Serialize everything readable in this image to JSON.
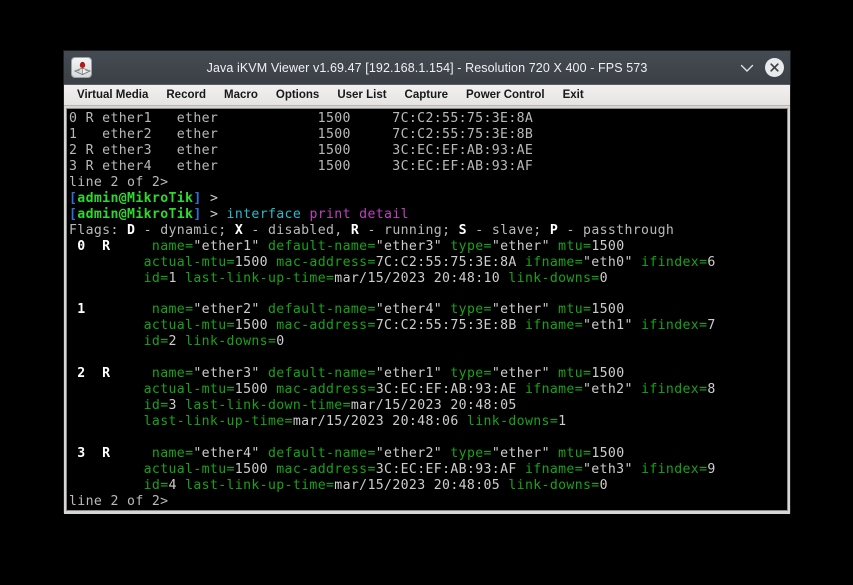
{
  "window": {
    "title": "Java iKVM Viewer v1.69.47 [192.168.1.154] - Resolution 720 X 400 - FPS 573",
    "app_icon": "java-ikvm-icon",
    "minimize_label": "⌄",
    "close_label": "✕"
  },
  "menubar": {
    "items": [
      {
        "label": "Virtual Media"
      },
      {
        "label": "Record"
      },
      {
        "label": "Macro"
      },
      {
        "label": "Options"
      },
      {
        "label": "User List"
      },
      {
        "label": "Capture"
      },
      {
        "label": "Power Control"
      },
      {
        "label": "Exit"
      }
    ]
  },
  "terminal": {
    "interface_table": [
      {
        "index": "0",
        "flags": "R",
        "name": "ether1",
        "type": "ether",
        "mtu": "1500",
        "mac": "7C:C2:55:75:3E:8A"
      },
      {
        "index": "1",
        "flags": "",
        "name": "ether2",
        "type": "ether",
        "mtu": "1500",
        "mac": "7C:C2:55:75:3E:8B"
      },
      {
        "index": "2",
        "flags": "R",
        "name": "ether3",
        "type": "ether",
        "mtu": "1500",
        "mac": "3C:EC:EF:AB:93:AE"
      },
      {
        "index": "3",
        "flags": "R",
        "name": "ether4",
        "type": "ether",
        "mtu": "1500",
        "mac": "3C:EC:EF:AB:93:AF"
      }
    ],
    "pager_top": "line 2 of 2>",
    "pager_bottom": "line 2 of 2>",
    "prompt_user": "admin@MikroTik",
    "prompt_bracket_open": "[",
    "prompt_bracket_close": "]",
    "prompt_arrow": ">",
    "command_part1": "interface",
    "command_part2": "print detail",
    "flags_line": "Flags: D - dynamic; X - disabled, R - running; S - slave; P - passthrough",
    "flags_prefix": "Flags: ",
    "flags_tokens": [
      {
        "flag": "D",
        "desc": " - dynamic; "
      },
      {
        "flag": "X",
        "desc": " - disabled, "
      },
      {
        "flag": "R",
        "desc": " - running; "
      },
      {
        "flag": "S",
        "desc": " - slave; "
      },
      {
        "flag": "P",
        "desc": " - passthrough"
      }
    ],
    "detail_entries": [
      {
        "index": "0",
        "flags": "R",
        "name": "ether1",
        "default_name": "ether3",
        "type": "ether",
        "mtu": "1500",
        "actual_mtu": "1500",
        "mac_address": "7C:C2:55:75:3E:8A",
        "ifname": "eth0",
        "ifindex": "6",
        "id": "1",
        "last_link_down_time": "",
        "last_link_up_time": "mar/15/2023 20:48:10",
        "link_downs": "0"
      },
      {
        "index": "1",
        "flags": "",
        "name": "ether2",
        "default_name": "ether4",
        "type": "ether",
        "mtu": "1500",
        "actual_mtu": "1500",
        "mac_address": "7C:C2:55:75:3E:8B",
        "ifname": "eth1",
        "ifindex": "7",
        "id": "2",
        "last_link_down_time": "",
        "last_link_up_time": "",
        "link_downs": "0"
      },
      {
        "index": "2",
        "flags": "R",
        "name": "ether3",
        "default_name": "ether1",
        "type": "ether",
        "mtu": "1500",
        "actual_mtu": "1500",
        "mac_address": "3C:EC:EF:AB:93:AE",
        "ifname": "eth2",
        "ifindex": "8",
        "id": "3",
        "last_link_down_time": "mar/15/2023 20:48:05",
        "last_link_up_time": "mar/15/2023 20:48:06",
        "link_downs": "1"
      },
      {
        "index": "3",
        "flags": "R",
        "name": "ether4",
        "default_name": "ether2",
        "type": "ether",
        "mtu": "1500",
        "actual_mtu": "1500",
        "mac_address": "3C:EC:EF:AB:93:AF",
        "ifname": "eth3",
        "ifindex": "9",
        "id": "4",
        "last_link_down_time": "",
        "last_link_up_time": "mar/15/2023 20:48:05",
        "link_downs": "0"
      }
    ],
    "labels": {
      "name": "name=",
      "default_name": "default-name=",
      "type": "type=",
      "mtu": "mtu=",
      "actual_mtu": "actual-mtu=",
      "mac_address": "mac-address=",
      "ifname": "ifname=",
      "ifindex": "ifindex=",
      "id": "id=",
      "last_link_down_time": "last-link-down-time=",
      "last_link_up_time": "last-link-up-time=",
      "link_downs": "link-downs="
    }
  },
  "colors": {
    "terminal_bg": "#000000",
    "terminal_fg": "#cdcdcd",
    "key_green": "#17a317",
    "prompt_blue": "#2b6fd8",
    "user_green": "#2fd82f",
    "cmd_cyan": "#2bb9c9",
    "cmd_magenta": "#c040c0",
    "titlebar_bg": "#3c4148",
    "menubar_bg": "#eeecea"
  }
}
